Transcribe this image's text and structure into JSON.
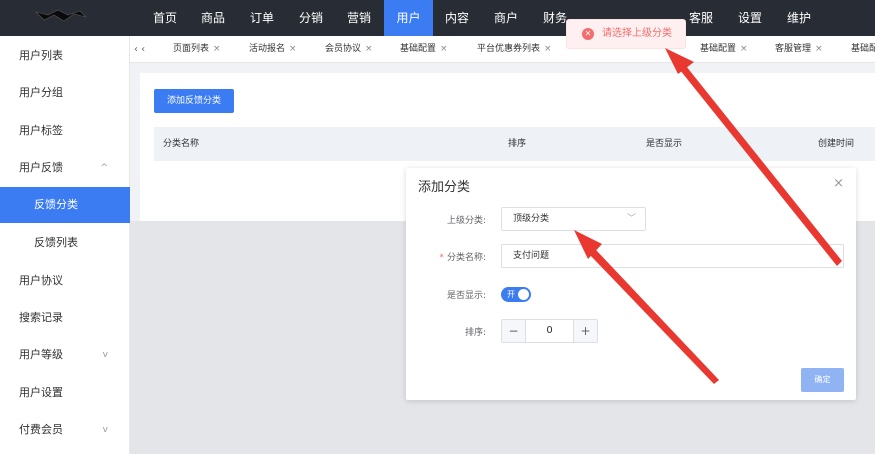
{
  "nav": {
    "items": [
      "首页",
      "商品",
      "订单",
      "分销",
      "营销",
      "用户",
      "内容",
      "商户",
      "财务",
      "客服",
      "设置",
      "维护"
    ],
    "active": "用户"
  },
  "sidebar": {
    "items": [
      {
        "label": "用户列表"
      },
      {
        "label": "用户分组"
      },
      {
        "label": "用户标签"
      },
      {
        "label": "用户反馈",
        "chevron": "^"
      },
      {
        "label": "反馈分类",
        "active": true
      },
      {
        "label": "反馈列表"
      },
      {
        "label": "用户协议"
      },
      {
        "label": "搜索记录"
      },
      {
        "label": "用户等级",
        "chevron": "v"
      },
      {
        "label": "用户设置"
      },
      {
        "label": "付费会员",
        "chevron": "v"
      }
    ]
  },
  "tabs": {
    "scroll_left": "‹ ‹",
    "items": [
      "页面列表",
      "活动报名",
      "会员协议",
      "基础配置",
      "平台优惠券列表",
      "基础配置",
      "客服管理",
      "基础配置"
    ],
    "close": "×"
  },
  "content": {
    "add_button": "添加反馈分类",
    "columns": [
      "分类名称",
      "排序",
      "是否显示",
      "创建时间"
    ]
  },
  "modal": {
    "title": "添加分类",
    "close": "×",
    "parent_label": "上级分类:",
    "parent_value": "顶级分类",
    "name_label": "分类名称:",
    "name_required": "*",
    "name_value": "支付问题",
    "show_label": "是否显示:",
    "show_switch_text": "开",
    "sort_label": "排序:",
    "sort_value": "0",
    "minus": "−",
    "plus": "+",
    "confirm": "确定"
  },
  "toast": {
    "message": "请选择上级分类",
    "icon": "error-icon",
    "color": "#f56c6c"
  },
  "colors": {
    "primary": "#3b7cf3",
    "topbar": "#282c34",
    "annotation_arrow": "#e8382f"
  }
}
